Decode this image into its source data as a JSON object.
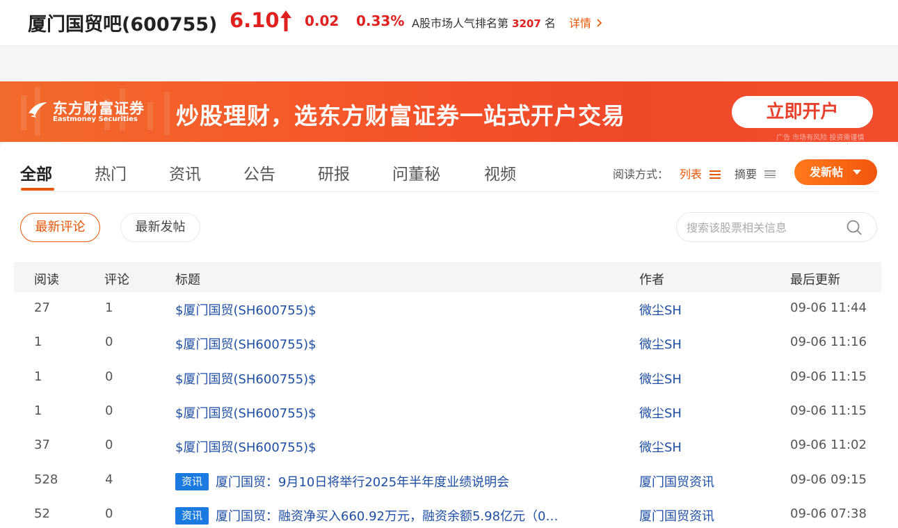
{
  "header": {
    "stock_name": "厦门国贸吧(600755)",
    "price": "6.10",
    "change": "0.02",
    "change_pct": "0.33%",
    "rank_prefix": "A股市场人气排名第",
    "rank_value": "3207",
    "rank_suffix": "名",
    "detail_link": "详情",
    "up_color": "#e0201f"
  },
  "banner": {
    "logo_cn": "东方财富证券",
    "logo_en": "Eastmoney Securities",
    "slogan": "炒股理财，选东方财富证券一站式开户交易",
    "button": "立即开户",
    "ad_note": "广告 市场有风险 投资需谨慎",
    "accent": "#f5582a"
  },
  "tabs": [
    {
      "label": "全部",
      "active": true
    },
    {
      "label": "热门",
      "active": false
    },
    {
      "label": "资讯",
      "active": false
    },
    {
      "label": "公告",
      "active": false
    },
    {
      "label": "研报",
      "active": false
    },
    {
      "label": "问董秘",
      "active": false
    },
    {
      "label": "视频",
      "active": false
    }
  ],
  "read_mode": {
    "label": "阅读方式：",
    "list": "列表",
    "summary": "摘要"
  },
  "post_button": "发新帖",
  "filters": {
    "latest_comment": "最新评论",
    "latest_post": "最新发帖"
  },
  "search": {
    "placeholder": "搜索该股票相关信息",
    "value": ""
  },
  "table": {
    "headers": [
      "阅读",
      "评论",
      "标题",
      "作者",
      "最后更新"
    ],
    "rows": [
      {
        "reads": "27",
        "comments": "1",
        "tag": "",
        "title": "$厦门国贸(SH600755)$",
        "author": "微尘SH",
        "updated": "09-06 11:44"
      },
      {
        "reads": "1",
        "comments": "0",
        "tag": "",
        "title": "$厦门国贸(SH600755)$",
        "author": "微尘SH",
        "updated": "09-06 11:16"
      },
      {
        "reads": "1",
        "comments": "0",
        "tag": "",
        "title": "$厦门国贸(SH600755)$",
        "author": "微尘SH",
        "updated": "09-06 11:15"
      },
      {
        "reads": "1",
        "comments": "0",
        "tag": "",
        "title": "$厦门国贸(SH600755)$",
        "author": "微尘SH",
        "updated": "09-06 11:15"
      },
      {
        "reads": "37",
        "comments": "0",
        "tag": "",
        "title": "$厦门国贸(SH600755)$",
        "author": "微尘SH",
        "updated": "09-06 11:02"
      },
      {
        "reads": "528",
        "comments": "4",
        "tag": "资讯",
        "title": "厦门国贸：9月10日将举行2025年半年度业绩说明会",
        "author": "厦门国贸资讯",
        "updated": "09-06 09:15"
      },
      {
        "reads": "52",
        "comments": "0",
        "tag": "资讯",
        "title": "厦门国贸：融资净买入660.92万元，融资余额5.98亿元（0…",
        "author": "厦门国贸资讯",
        "updated": "09-06 07:38"
      }
    ]
  }
}
